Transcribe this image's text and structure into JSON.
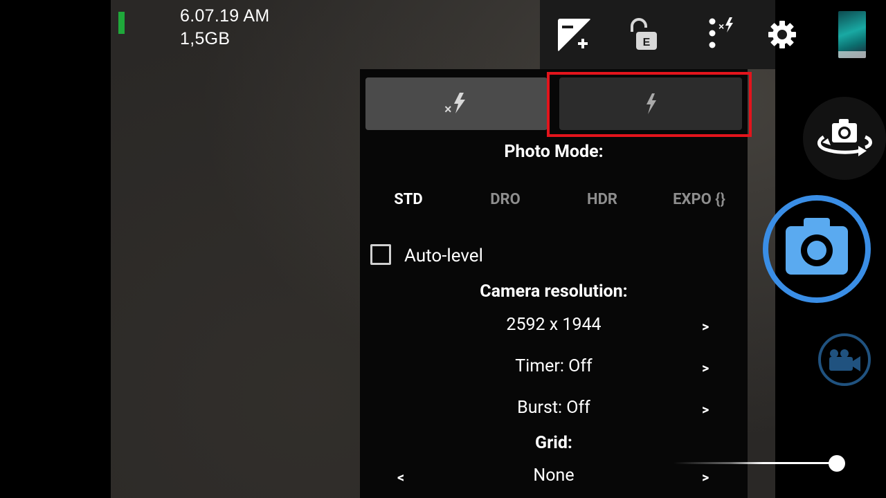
{
  "status": {
    "time": "6.07.19 AM",
    "free_memory": "1,5GB",
    "level_indicator_color": "#1fa83a"
  },
  "top_bar": {
    "icons": [
      "exposure-icon",
      "exposure-lock-icon",
      "flash-options-icon",
      "settings-icon"
    ],
    "gallery_thumbnail": "gallery-thumbnail"
  },
  "popup": {
    "flash_buttons": [
      {
        "name": "flash-off-icon",
        "selected": true
      },
      {
        "name": "flash-on-icon",
        "selected": false
      }
    ],
    "photo_mode_title": "Photo Mode:",
    "photo_modes": [
      "STD",
      "DRO",
      "HDR",
      "EXPO {}"
    ],
    "selected_mode": "STD",
    "auto_level_label": "Auto-level",
    "auto_level_checked": false,
    "camera_resolution_title": "Camera resolution:",
    "camera_resolution_value": "2592 x 1944",
    "timer_label": "Timer: Off",
    "burst_label": "Burst: Off",
    "grid_title": "Grid:",
    "grid_value": "None",
    "next_arrow": ">",
    "prev_arrow": "<"
  },
  "right_controls": {
    "shutter_color": "#3a8ee6",
    "shutter_icon_color": "#5aaaf0",
    "video_color": "#20527f",
    "zoom_level": 1.0
  },
  "highlight_color": "#e3141c"
}
